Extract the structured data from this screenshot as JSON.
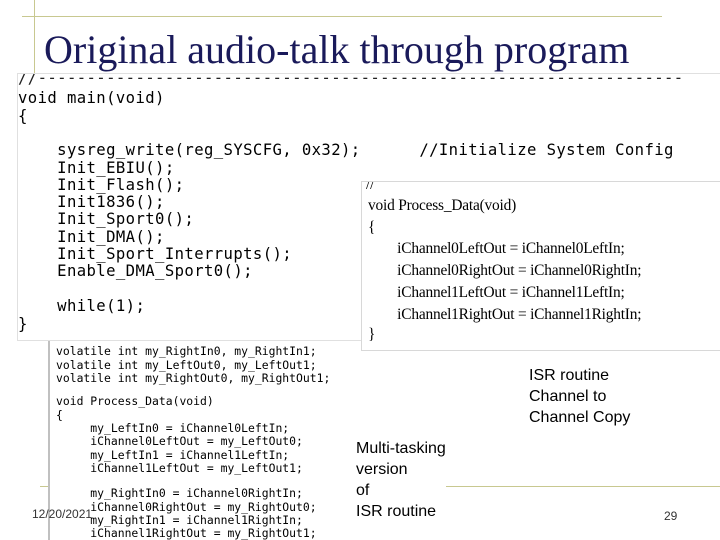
{
  "slide": {
    "title": "Original audio-talk through program",
    "date": "12/20/2021",
    "page_number": "29"
  },
  "main_code": {
    "lines": [
      "//------------------------------------------------------------------",
      "void main(void)",
      "{",
      "",
      "    sysreg_write(reg_SYSCFG, 0x32);      //Initialize System Config",
      "    Init_EBIU();",
      "    Init_Flash();",
      "    Init1836();",
      "    Init_Sport0();",
      "    Init_DMA();",
      "    Init_Sport_Interrupts();",
      "    Enable_DMA_Sport0();",
      "",
      "    while(1);",
      "}"
    ]
  },
  "isr_code": {
    "lines": [
      "//",
      "void Process_Data(void)",
      "{",
      "        iChannel0LeftOut = iChannel0LeftIn;",
      "        iChannel0RightOut = iChannel0RightIn;",
      "        iChannel1LeftOut = iChannel1LeftIn;",
      "        iChannel1RightOut = iChannel1RightIn;",
      "}"
    ]
  },
  "lower_code": {
    "lines": [
      "volatile int my_RightIn0, my_RightIn1;",
      "volatile int my_LeftOut0, my_LeftOut1;",
      "volatile int my_RightOut0, my_RightOut1;",
      "",
      "void Process_Data(void)",
      "{",
      "     my_LeftIn0 = iChannel0LeftIn;",
      "     iChannel0LeftOut = my_LeftOut0;",
      "     my_LeftIn1 = iChannel1LeftIn;",
      "     iChannel1LeftOut = my_LeftOut1;",
      "",
      "     my_RightIn0 = iChannel0RightIn;",
      "     iChannel0RightOut = my_RightOut0;",
      "     my_RightIn1 = iChannel1RightIn;",
      "     iChannel1RightOut = my_RightOut1;"
    ]
  },
  "labels": {
    "isr_copy": "ISR routine\nChannel to\nChannel Copy",
    "multitasking": "Multi-tasking\nversion\nof\nISR routine"
  }
}
